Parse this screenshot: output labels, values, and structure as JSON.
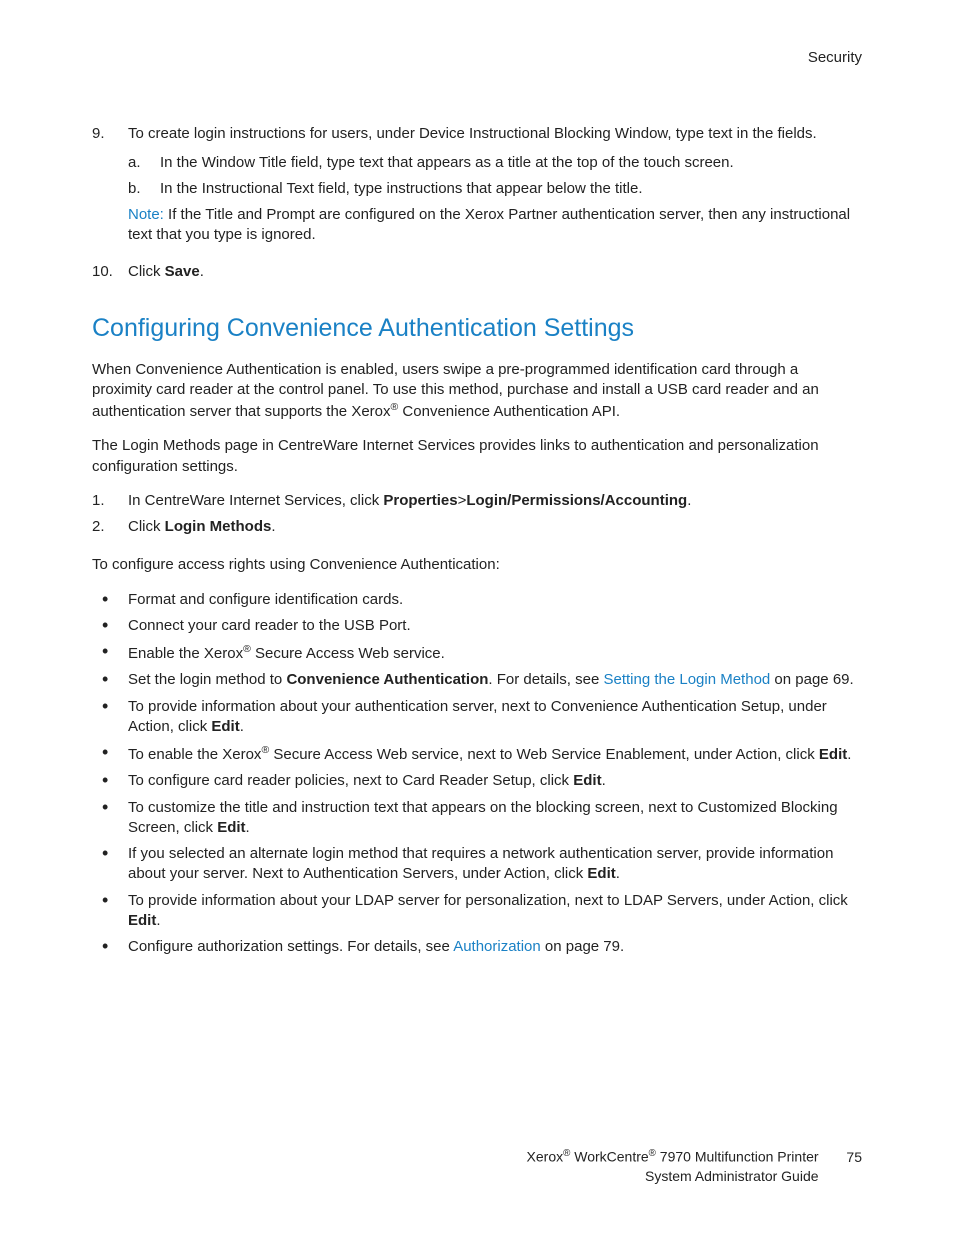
{
  "header": {
    "section": "Security"
  },
  "list1": {
    "item9": {
      "num": "9.",
      "text": "To create login instructions for users, under Device Instructional Blocking Window, type text in the fields.",
      "sub_a_letter": "a.",
      "sub_a_text": "In the Window Title field, type text that appears as a title at the top of the touch screen.",
      "sub_b_letter": "b.",
      "sub_b_text": "In the Instructional Text field, type instructions that appear below the title.",
      "note_label": "Note:",
      "note_text": " If the Title and Prompt are configured on the Xerox Partner authentication server, then any instructional text that you type is ignored."
    },
    "item10": {
      "num": "10.",
      "text_pre": "Click ",
      "text_bold": "Save",
      "text_post": "."
    }
  },
  "section": {
    "title": "Configuring Convenience Authentication Settings",
    "intro1_a": "When Convenience Authentication is enabled, users swipe a pre-programmed identification card through a proximity card reader at the control panel. To use this method, purchase and install a USB card reader and an authentication server that supports the Xerox",
    "intro1_b": " Convenience Authentication API.",
    "intro2": "The Login Methods page in CentreWare Internet Services provides links to authentication and personalization configuration settings.",
    "step1_num": "1.",
    "step1_a": "In CentreWare Internet Services, click ",
    "step1_bold": "Properties",
    "step1_gt": ">",
    "step1_bold2": "Login/Permissions/Accounting",
    "step1_dot": ".",
    "step2_num": "2.",
    "step2_a": "Click ",
    "step2_bold": "Login Methods",
    "step2_dot": ".",
    "para3": "To configure access rights using Convenience Authentication:",
    "b1": "Format and configure identification cards.",
    "b2": "Connect your card reader to the USB Port.",
    "b3_a": "Enable the Xerox",
    "b3_b": " Secure Access Web service.",
    "b4_a": "Set the login method to ",
    "b4_bold": "Convenience Authentication",
    "b4_b": ". For details, see ",
    "b4_link": "Setting the Login Method",
    "b4_c": " on page 69.",
    "b5_a": "To provide information about your authentication server, next to Convenience Authentication Setup, under Action, click ",
    "b5_bold": "Edit",
    "b5_dot": ".",
    "b6_a": "To enable the Xerox",
    "b6_b": " Secure Access Web service, next to Web Service Enablement, under Action, click ",
    "b6_bold": "Edit",
    "b6_dot": ".",
    "b7_a": "To configure card reader policies, next to Card Reader Setup, click ",
    "b7_bold": "Edit",
    "b7_dot": ".",
    "b8_a": "To customize the title and instruction text that appears on the blocking screen, next to Customized Blocking Screen, click ",
    "b8_bold": "Edit",
    "b8_dot": ".",
    "b9_a": "If you selected an alternate login method that requires a network authentication server, provide information about your server. Next to Authentication Servers, under Action, click ",
    "b9_bold": "Edit",
    "b9_dot": ".",
    "b10_a": "To provide information about your LDAP server for personalization, next to LDAP Servers, under Action, click ",
    "b10_bold": "Edit",
    "b10_dot": ".",
    "b11_a": "Configure authorization settings. For details, see ",
    "b11_link": "Authorization",
    "b11_b": " on page 79."
  },
  "footer": {
    "line1_a": "Xerox",
    "line1_b": " WorkCentre",
    "line1_c": " 7970 Multifunction Printer",
    "line2": "System Administrator Guide",
    "page": "75"
  }
}
